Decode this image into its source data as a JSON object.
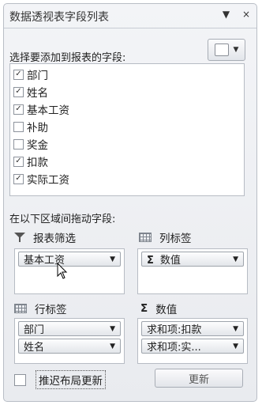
{
  "panel": {
    "title": "数据透视表字段列表",
    "pin_icon": "▼",
    "close_icon": "×"
  },
  "choose_label": "选择要添加到报表的字段:",
  "fields": [
    {
      "name": "部门",
      "checked": true
    },
    {
      "name": "姓名",
      "checked": true
    },
    {
      "name": "基本工资",
      "checked": true
    },
    {
      "name": "补助",
      "checked": false
    },
    {
      "name": "奖金",
      "checked": false
    },
    {
      "name": "扣款",
      "checked": true
    },
    {
      "name": "实际工资",
      "checked": true
    }
  ],
  "drag_label": "在以下区域间拖动字段:",
  "zones": {
    "filter": {
      "label": "报表筛选",
      "items": [
        "基本工资"
      ]
    },
    "columns": {
      "label": "列标签",
      "items": [
        "数值"
      ]
    },
    "rows": {
      "label": "行标签",
      "items": [
        "部门",
        "姓名"
      ]
    },
    "values": {
      "label": "数值",
      "items": [
        "求和项:扣款",
        "求和项:实..."
      ]
    }
  },
  "defer_label": "推迟布局更新",
  "update_label": "更新"
}
